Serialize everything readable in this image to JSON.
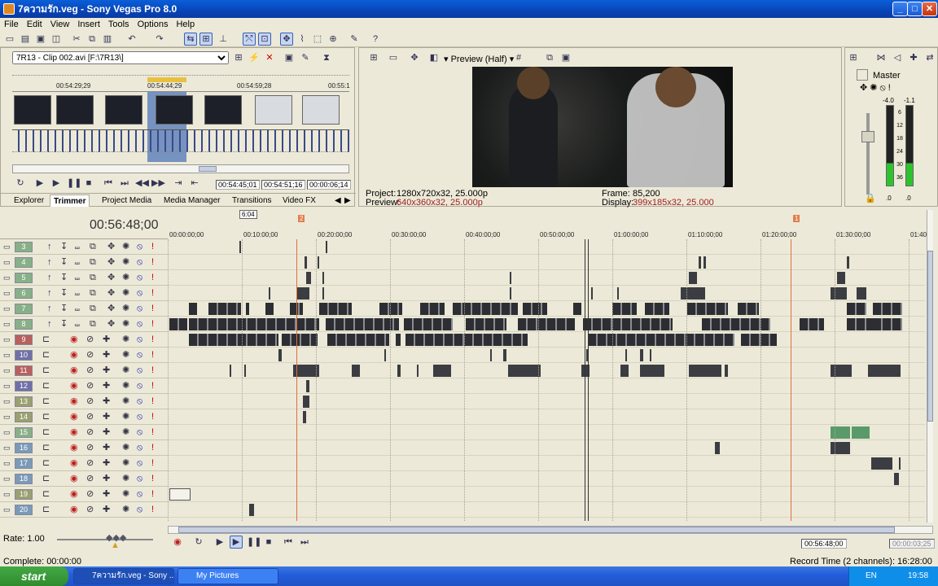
{
  "window": {
    "title": "7ความรัก.veg - Sony Vegas Pro 8.0",
    "minimize": "_",
    "maximize": "□",
    "close": "✕"
  },
  "menu": [
    "File",
    "Edit",
    "View",
    "Insert",
    "Tools",
    "Options",
    "Help"
  ],
  "trimmer": {
    "source": "7R13 - Clip 002.avi   [F:\\7R13\\]",
    "ruler": [
      "00:54:29;29",
      "00:54:44;29",
      "00:54:59;28",
      "00:55:1"
    ],
    "times": [
      "00:54:45;01",
      "00:54:51;16",
      "00:00:06;14"
    ],
    "tabs": [
      "Explorer",
      "Trimmer",
      "Project Media",
      "Media Manager",
      "Transitions",
      "Video FX"
    ],
    "selected_tab": "Trimmer"
  },
  "preview": {
    "mode": "Preview (Half)",
    "project_label": "Project:",
    "project_value": "1280x720x32, 25.000p",
    "preview_label": "Preview:",
    "preview_value": "640x360x32, 25.000p",
    "frame_label": "Frame:",
    "frame_value": "85,200",
    "display_label": "Display:",
    "display_value": "399x185x32, 25.000"
  },
  "master": {
    "title": "Master",
    "left_db": "-4.0",
    "right_db": "-1.1",
    "scale": [
      "6",
      "12",
      "18",
      "24",
      "30",
      "36"
    ],
    "foot_left": ".0",
    "foot_right": ".0"
  },
  "timeline": {
    "current_time": "00:56:48;00",
    "region_length": "6:04",
    "marker_a": "2",
    "marker_b": "1",
    "ruler": [
      "00:00:00;00",
      "00:10:00;00",
      "00:20:00;00",
      "00:30:00;00",
      "00:40:00;00",
      "00:50:00;00",
      "01:00:00;00",
      "01:10:00;00",
      "01:20:00;00",
      "01:30:00;00",
      "01:40"
    ],
    "tracks": [
      "3",
      "4",
      "5",
      "6",
      "7",
      "8",
      "9",
      "10",
      "11",
      "12",
      "13",
      "14",
      "15",
      "16",
      "17",
      "18",
      "19",
      "20"
    ]
  },
  "status": {
    "rate": "Rate: 1.00",
    "complete": "Complete: 00:00:00",
    "time": "00:56:48;00",
    "time2": "00:00:03;25",
    "record": "Record Time (2 channels): 16:28:00"
  },
  "taskbar": {
    "start": "start",
    "tasks": [
      "7ความรัก.veg - Sony ...",
      "My Pictures"
    ],
    "lang": "EN",
    "clock": "19:58"
  }
}
